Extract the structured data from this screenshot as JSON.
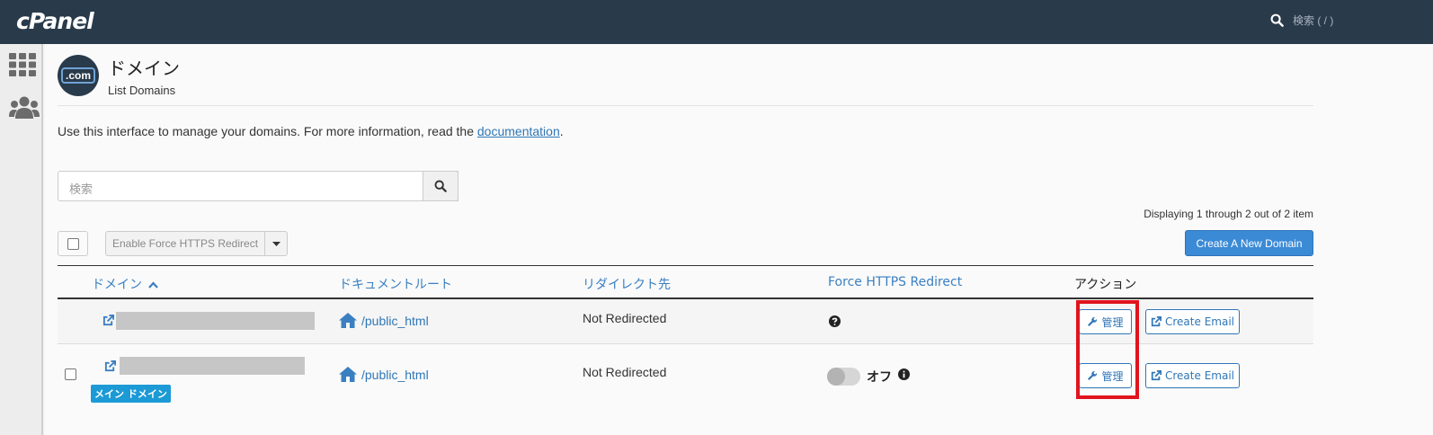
{
  "topbar": {
    "logo": "cPanel",
    "search_label": "検索 ( / )"
  },
  "header": {
    "icon_text": ".com",
    "title": "ドメイン",
    "subtitle": "List Domains"
  },
  "intro": {
    "text": "Use this interface to manage your domains. For more information, read the ",
    "link": "documentation",
    "suffix": "."
  },
  "search": {
    "placeholder": "検索"
  },
  "pagination": {
    "text": "Displaying 1 through 2 out of 2 item"
  },
  "toolbar": {
    "https_button": "Enable Force HTTPS Redirect",
    "create_button": "Create A New Domain"
  },
  "table": {
    "headers": {
      "domain": "ドメイン",
      "docroot": "ドキュメントルート",
      "redirect": "リダイレクト先",
      "https": "Force HTTPS Redirect",
      "actions": "アクション"
    },
    "rows": [
      {
        "docroot": "/public_html",
        "redirect": "Not Redirected",
        "manage": "管理",
        "email": "Create Email"
      },
      {
        "docroot": "/public_html",
        "redirect": "Not Redirected",
        "badge": "メイン ドメイン",
        "https_state": "オフ",
        "manage": "管理",
        "email": "Create Email"
      }
    ]
  },
  "colors": {
    "topbar": "#293a4a",
    "link": "#2f76b6",
    "primary": "#3b8ad6",
    "badge": "#1c9ad6",
    "highlight": "#e0141e"
  }
}
